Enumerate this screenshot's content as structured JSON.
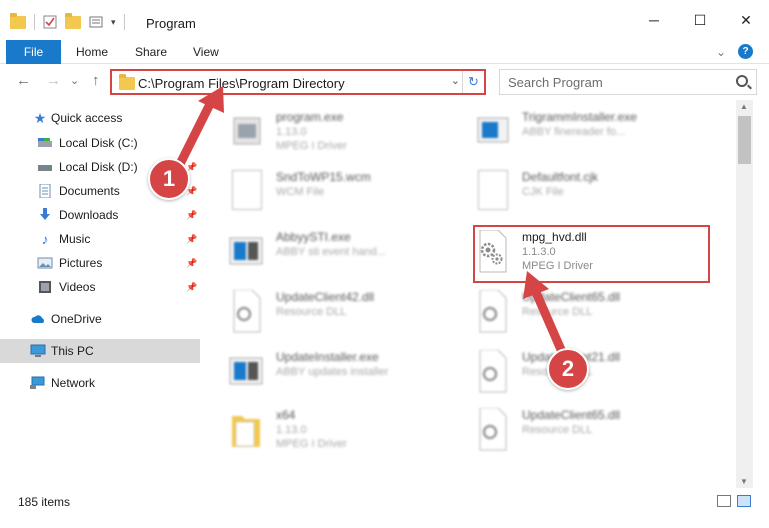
{
  "window": {
    "title": "Program",
    "minimize": "─",
    "maximize": "☐",
    "close": "✕"
  },
  "ribbon": {
    "tabs": [
      "File",
      "Home",
      "Share",
      "View"
    ],
    "expand": "⌄",
    "help": "?"
  },
  "nav": {
    "back": "←",
    "forward": "→",
    "recent": "⌄",
    "up": "↑",
    "address": "C:\\Program Files\\Program Directory",
    "address_dropdown": "⌄",
    "refresh": "↻",
    "search_placeholder": "Search Program"
  },
  "sidebar": {
    "items": [
      {
        "label": "Quick access",
        "icon": "star-icon",
        "pinned": false
      },
      {
        "label": "Local Disk (C:)",
        "icon": "drive-icon",
        "pinned": false
      },
      {
        "label": "Local Disk (D:)",
        "icon": "drive-icon",
        "pinned": true
      },
      {
        "label": "Documents",
        "icon": "documents-icon",
        "pinned": true
      },
      {
        "label": "Downloads",
        "icon": "downloads-icon",
        "pinned": true
      },
      {
        "label": "Music",
        "icon": "music-icon",
        "pinned": true
      },
      {
        "label": "Pictures",
        "icon": "pictures-icon",
        "pinned": true
      },
      {
        "label": "Videos",
        "icon": "videos-icon",
        "pinned": true
      },
      {
        "label": "OneDrive",
        "icon": "onedrive-icon",
        "pinned": false
      },
      {
        "label": "This PC",
        "icon": "pc-icon",
        "pinned": false,
        "selected": true
      },
      {
        "label": "Network",
        "icon": "network-icon",
        "pinned": false
      }
    ]
  },
  "files": [
    {
      "name": "program.exe",
      "line1": "1.13.0",
      "line2": "MPEG I Driver",
      "icon": "app-icon",
      "blurred": true
    },
    {
      "name": "TrigrammInstaller.exe",
      "line1": "ABBY finereader fo...",
      "line2": "",
      "icon": "installer-icon",
      "blurred": true
    },
    {
      "name": "SndToWP15.wcm",
      "line1": "WCM File",
      "line2": "",
      "icon": "file-icon",
      "blurred": true
    },
    {
      "name": "Defaultfont.cjk",
      "line1": "CJK File",
      "line2": "",
      "icon": "file-icon",
      "blurred": true
    },
    {
      "name": "AbbyySTI.exe",
      "line1": "ABBY sti event hand...",
      "line2": "",
      "icon": "installer-icon",
      "blurred": true
    },
    {
      "name": "mpg_hvd.dll",
      "line1": "1.1.3.0",
      "line2": "MPEG I Driver",
      "icon": "dll-gear-icon",
      "blurred": false
    },
    {
      "name": "UpdateClient42.dll",
      "line1": "Resource DLL",
      "line2": "",
      "icon": "dll-gear-icon",
      "blurred": true
    },
    {
      "name": "UpdateClient65.dll",
      "line1": "Resource DLL",
      "line2": "",
      "icon": "dll-gear-icon",
      "blurred": true
    },
    {
      "name": "UpdateInstaller.exe",
      "line1": "ABBY updates installer",
      "line2": "",
      "icon": "installer-icon",
      "blurred": true
    },
    {
      "name": "UpdateClient21.dll",
      "line1": "Resource DLL",
      "line2": "",
      "icon": "dll-gear-icon",
      "blurred": true
    },
    {
      "name": "x64",
      "line1": "1.13.0",
      "line2": "MPEG I Driver",
      "icon": "folder-icon",
      "blurred": true
    },
    {
      "name": "UpdateClient65.dll",
      "line1": "Resource DLL",
      "line2": "",
      "icon": "dll-gear-icon",
      "blurred": true
    }
  ],
  "status": {
    "count": "185 items"
  },
  "callouts": [
    "1",
    "2"
  ],
  "colors": {
    "accent": "#1979ca",
    "highlight": "#d64545",
    "selected": "#d9d9d9"
  }
}
